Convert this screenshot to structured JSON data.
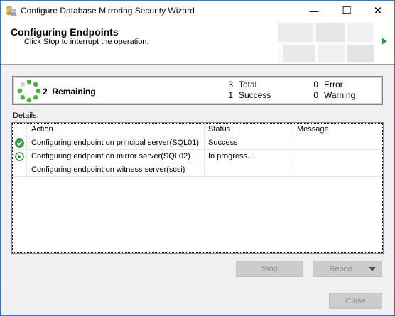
{
  "window": {
    "title": "Configure Database Mirroring Security Wizard"
  },
  "window_controls": {
    "minimize": "—",
    "maximize": "☐",
    "close": "✕"
  },
  "header": {
    "title": "Configuring Endpoints",
    "subtitle": "Click Stop to interrupt the operation."
  },
  "progress": {
    "remaining_count": "2",
    "remaining_label": "Remaining",
    "total_count": "3",
    "total_label": "Total",
    "success_count": "1",
    "success_label": "Success",
    "error_count": "0",
    "error_label": "Error",
    "warning_count": "0",
    "warning_label": "Warning"
  },
  "details": {
    "label": "Details:",
    "columns": {
      "action": "Action",
      "status": "Status",
      "message": "Message"
    },
    "rows": [
      {
        "icon": "success-check-icon",
        "action": "Configuring endpoint on principal server(SQL01)",
        "status": "Success",
        "message": ""
      },
      {
        "icon": "in-progress-arrow-icon",
        "action": "Configuring endpoint on mirror server(SQL02)",
        "status": "In progress...",
        "message": ""
      },
      {
        "icon": "",
        "action": "Configuring endpoint on witness server(scsi)",
        "status": "",
        "message": ""
      }
    ]
  },
  "buttons": {
    "stop": "Stop",
    "report": "Report",
    "close": "Close"
  },
  "colors": {
    "accent_border": "#2b79d6",
    "success_green": "#3aa046",
    "spinner_green": "#4cae3c"
  }
}
